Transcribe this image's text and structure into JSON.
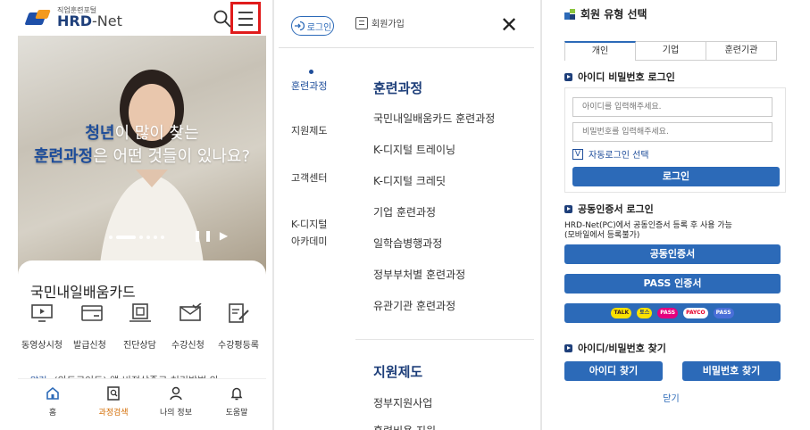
{
  "panel1": {
    "logo_sub": "직업훈련포털",
    "logo_main": "HRD",
    "logo_main_suffix": "-Net",
    "hero_line1_em": "청년",
    "hero_line1_rest": "이 많이 찾는",
    "hero_line2_em": "훈련과정",
    "hero_line2_rest": "은 어떤 것들이 있나요?",
    "card_title": "국민내일배움카드",
    "card_items": [
      {
        "label": "동영상시청",
        "icon": "monitor-icon"
      },
      {
        "label": "발급신청",
        "icon": "card-icon"
      },
      {
        "label": "진단상담",
        "icon": "consult-icon"
      },
      {
        "label": "수강신청",
        "icon": "mail-check-icon"
      },
      {
        "label": "수강평등록",
        "icon": "edit-doc-icon"
      }
    ],
    "notice_tag": "알림",
    "notice_text": "(안드로이드) 앱 비정상종료 처리방법 안...",
    "tabs": [
      {
        "label": "홈",
        "icon": "home-icon"
      },
      {
        "label": "과정검색",
        "icon": "search-doc-icon"
      },
      {
        "label": "나의 정보",
        "icon": "user-icon"
      },
      {
        "label": "도움말",
        "icon": "bell-icon"
      }
    ]
  },
  "panel2": {
    "login_label": "로그인",
    "join_label": "회원가입",
    "close_label": "✕",
    "left_menu": [
      "훈련과정",
      "지원제도",
      "고객센터",
      "K-디지털",
      "아카데미"
    ],
    "section1_title": "훈련과정",
    "section1_items": [
      "국민내일배움카드 훈련과정",
      "K-디지털 트레이닝",
      "K-디지털 크레딧",
      "기업 훈련과정",
      "일학습병행과정",
      "정부부처별 훈련과정",
      "유관기관 훈련과정"
    ],
    "section2_title": "지원제도",
    "section2_items": [
      "정부지원사업",
      "훈련비용 지원"
    ]
  },
  "panel3": {
    "title": "회원 유형 선택",
    "tabs": [
      "개인",
      "기업",
      "훈련기관"
    ],
    "id_login_title": "아이디 비밀번호 로그인",
    "id_placeholder": "아이디를 입력해주세요.",
    "pw_placeholder": "비밀번호를 입력해주세요.",
    "auto_check": "V",
    "auto_label": "자동로그인 선택",
    "login_button": "로그인",
    "cert_title": "공동인증서 로그인",
    "cert_desc1": "HRD-Net(PC)에서 공동인증서 등록 후 사용 가능",
    "cert_desc2": "(모바일에서 등록불가)",
    "cert_button": "공동인증서",
    "pass_button": "PASS 인증서",
    "cert_logos": [
      "TALK",
      "토스",
      "PASS",
      "PAYCO",
      "PASS"
    ],
    "find_title": "아이디/비밀번호 찾기",
    "find_id": "아이디 찾기",
    "find_pw": "비밀번호 찾기",
    "close": "닫기"
  },
  "colors": {
    "brand_blue": "#2c6ab8",
    "navy": "#1e3f7a",
    "highlight_red": "#e01b1b",
    "orange": "#f39a1e"
  }
}
